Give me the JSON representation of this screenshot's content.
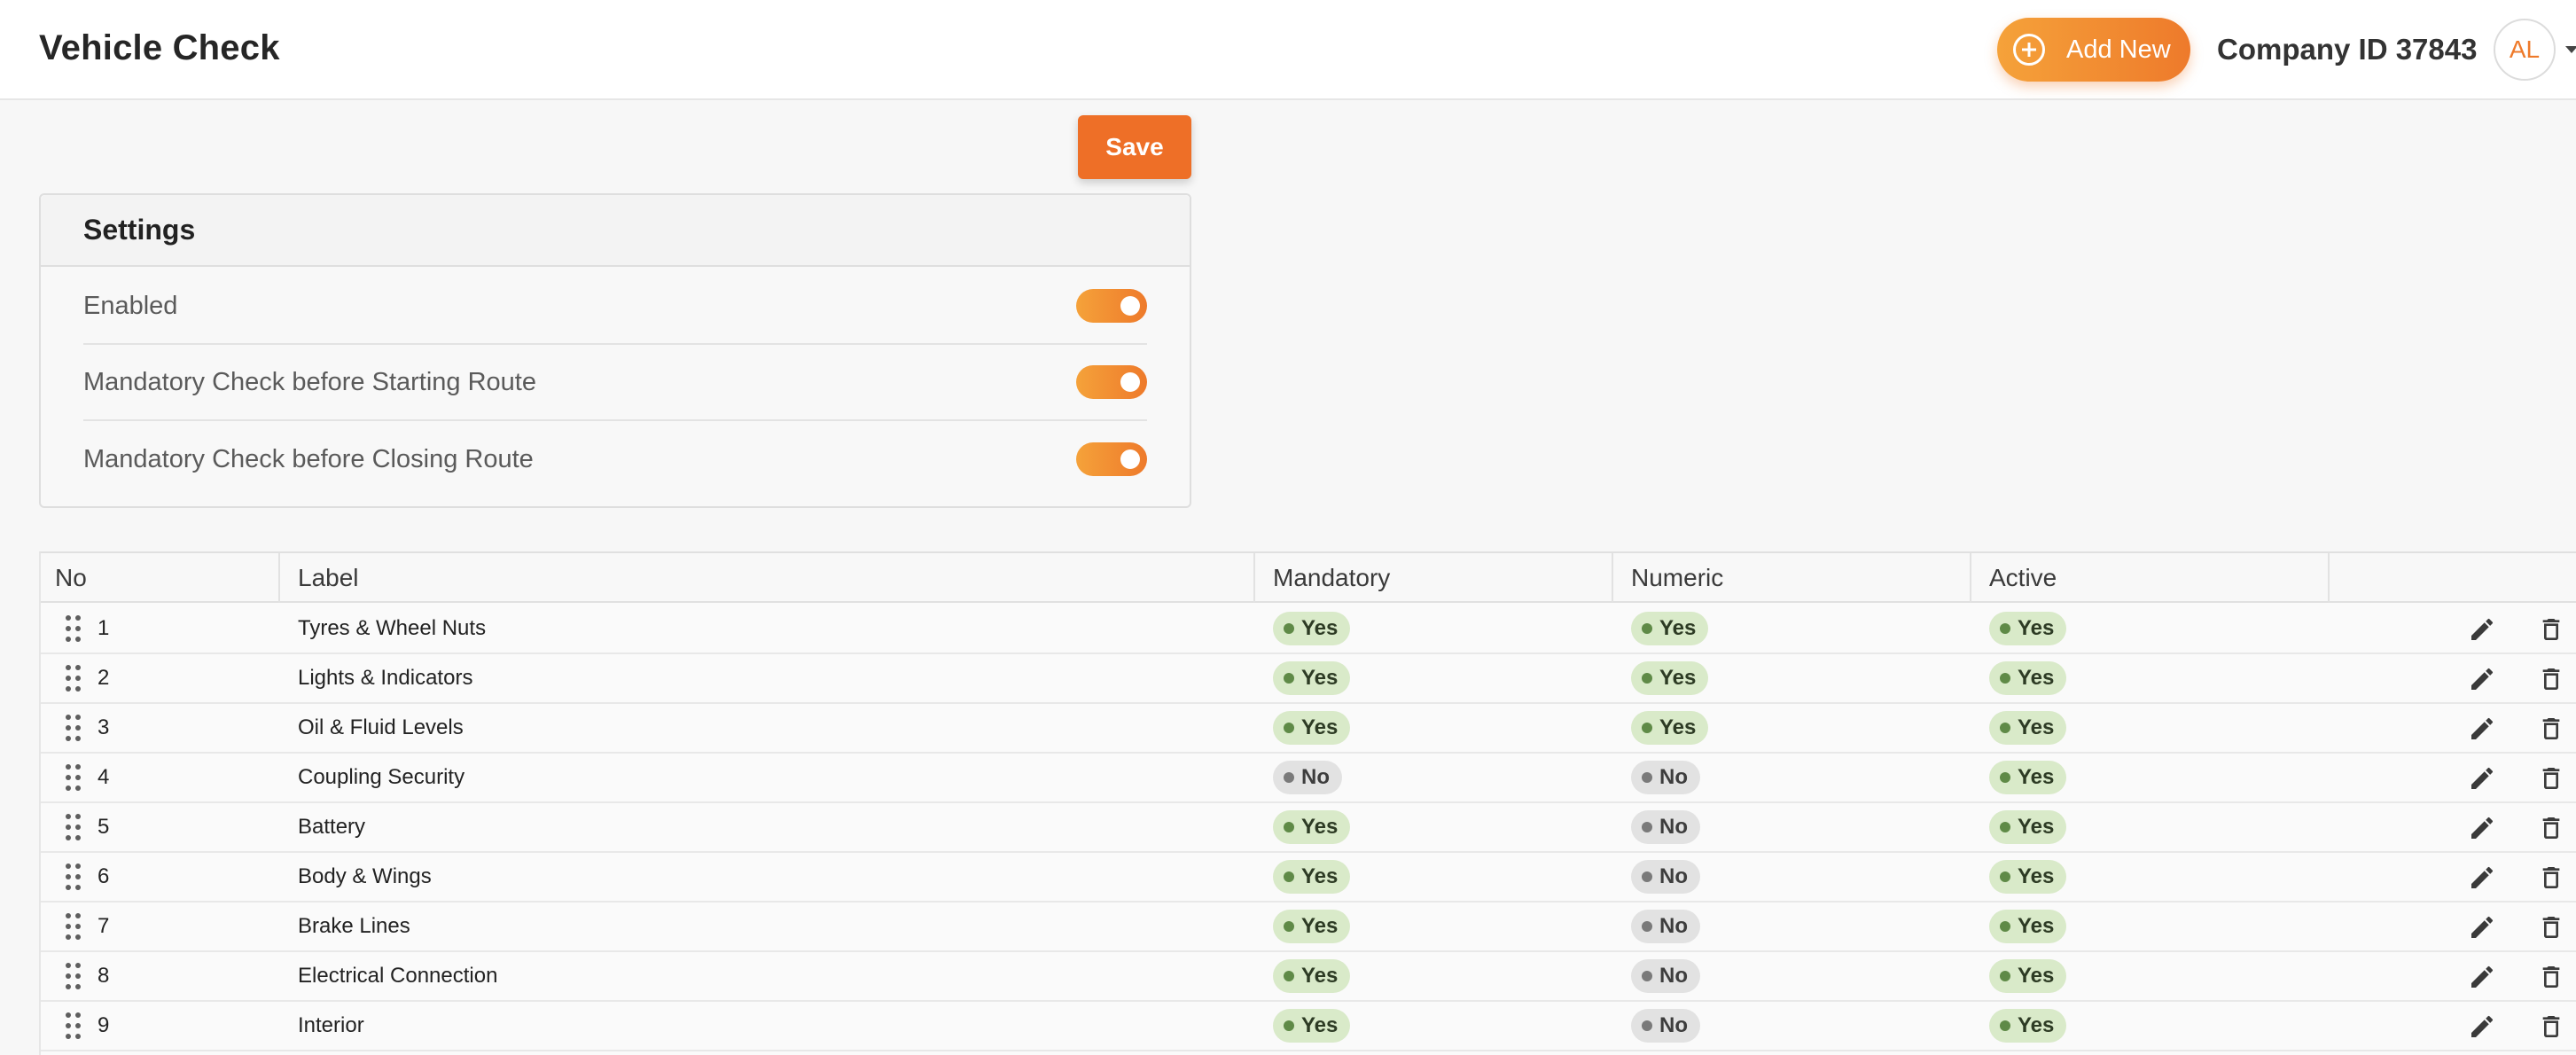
{
  "header": {
    "title": "Vehicle Check",
    "add_new_label": "Add New",
    "company_label": "Company ID 37843",
    "avatar_initials": "AL"
  },
  "toolbar": {
    "save_label": "Save"
  },
  "settings": {
    "title": "Settings",
    "items": [
      {
        "label": "Enabled",
        "on": true
      },
      {
        "label": "Mandatory Check before Starting Route",
        "on": true
      },
      {
        "label": "Mandatory Check before Closing Route",
        "on": true
      }
    ]
  },
  "table": {
    "columns": [
      "No",
      "Label",
      "Mandatory",
      "Numeric",
      "Active"
    ],
    "rows": [
      {
        "no": "1",
        "label": "Tyres & Wheel Nuts",
        "mandatory": "Yes",
        "numeric": "Yes",
        "active": "Yes"
      },
      {
        "no": "2",
        "label": "Lights & Indicators",
        "mandatory": "Yes",
        "numeric": "Yes",
        "active": "Yes"
      },
      {
        "no": "3",
        "label": "Oil & Fluid Levels",
        "mandatory": "Yes",
        "numeric": "Yes",
        "active": "Yes"
      },
      {
        "no": "4",
        "label": "Coupling Security",
        "mandatory": "No",
        "numeric": "No",
        "active": "Yes"
      },
      {
        "no": "5",
        "label": "Battery",
        "mandatory": "Yes",
        "numeric": "No",
        "active": "Yes"
      },
      {
        "no": "6",
        "label": "Body & Wings",
        "mandatory": "Yes",
        "numeric": "No",
        "active": "Yes"
      },
      {
        "no": "7",
        "label": "Brake Lines",
        "mandatory": "Yes",
        "numeric": "No",
        "active": "Yes"
      },
      {
        "no": "8",
        "label": "Electrical Connection",
        "mandatory": "Yes",
        "numeric": "No",
        "active": "Yes"
      },
      {
        "no": "9",
        "label": "Interior",
        "mandatory": "Yes",
        "numeric": "No",
        "active": "Yes"
      }
    ]
  },
  "colors": {
    "accent": "#ee7a2b",
    "chip_yes_bg": "#d9eac9",
    "chip_no_bg": "#e2e2e2"
  },
  "icons": {
    "add": "plus-circle-icon",
    "drag": "drag-handle-icon",
    "edit": "pencil-icon",
    "delete": "trash-icon"
  }
}
